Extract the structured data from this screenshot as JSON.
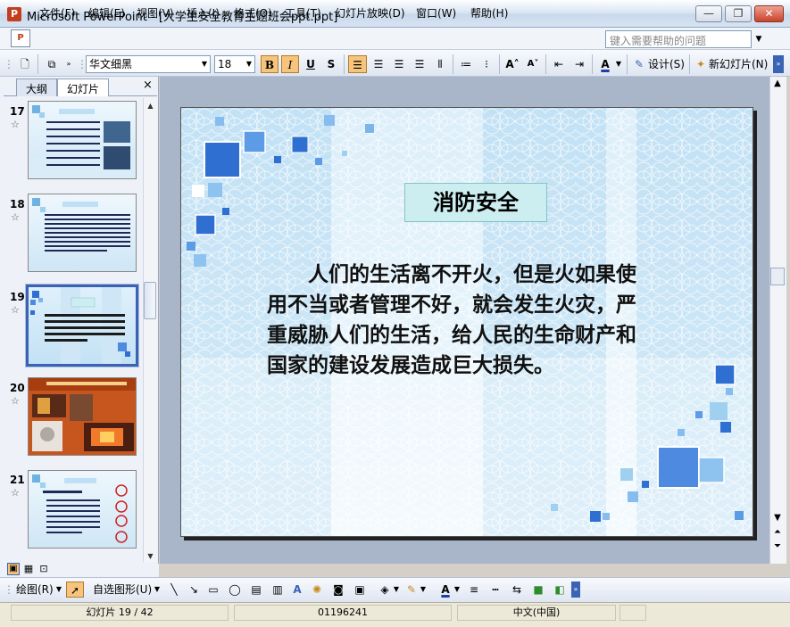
{
  "window": {
    "title": "Microsoft PowerPoint - [大学生安全教育主题班会ppt.ppt]",
    "minimize_symbol": "—",
    "restore_symbol": "❐",
    "close_symbol": "✕"
  },
  "menu": {
    "items": [
      "文件(F)",
      "编辑(E)",
      "视图(V)",
      "插入(I)",
      "格式(O)",
      "工具(T)",
      "幻灯片放映(D)",
      "窗口(W)",
      "帮助(H)"
    ],
    "help_placeholder": "键入需要帮助的问题"
  },
  "toolbar": {
    "font_name": "华文细黑",
    "font_size": "18",
    "bold": "B",
    "italic": "I",
    "underline": "U",
    "shadow": "S",
    "design_label": "设计(S)",
    "new_slide_label": "新幻灯片(N)"
  },
  "left_pane": {
    "tabs": [
      "大纲",
      "幻灯片"
    ],
    "close_symbol": "×",
    "thumbnails": [
      {
        "number": "17",
        "star": "☆"
      },
      {
        "number": "18",
        "star": "☆"
      },
      {
        "number": "19",
        "star": "☆",
        "selected": true
      },
      {
        "number": "20",
        "star": "☆"
      },
      {
        "number": "21",
        "star": "☆"
      }
    ]
  },
  "slide": {
    "title": "消防安全",
    "body": "人们的生活离不开火，但是火如果使用不当或者管理不好，就会发生火灾，严重威胁人们的生活，给人民的生命财产和国家的建设发展造成巨大损失。"
  },
  "drawing_toolbar": {
    "draw_label": "绘图(R)",
    "autoshapes_label": "自选图形(U)"
  },
  "status_bar": {
    "slide_position": "幻灯片 19 / 42",
    "design": "01196241",
    "language": "中文(中国)"
  },
  "colors": {
    "accent": "#3a63b3",
    "slide_background": "#eaf4fb",
    "title_box": "#cdeef0",
    "square_blue": "#2f6fd1"
  }
}
